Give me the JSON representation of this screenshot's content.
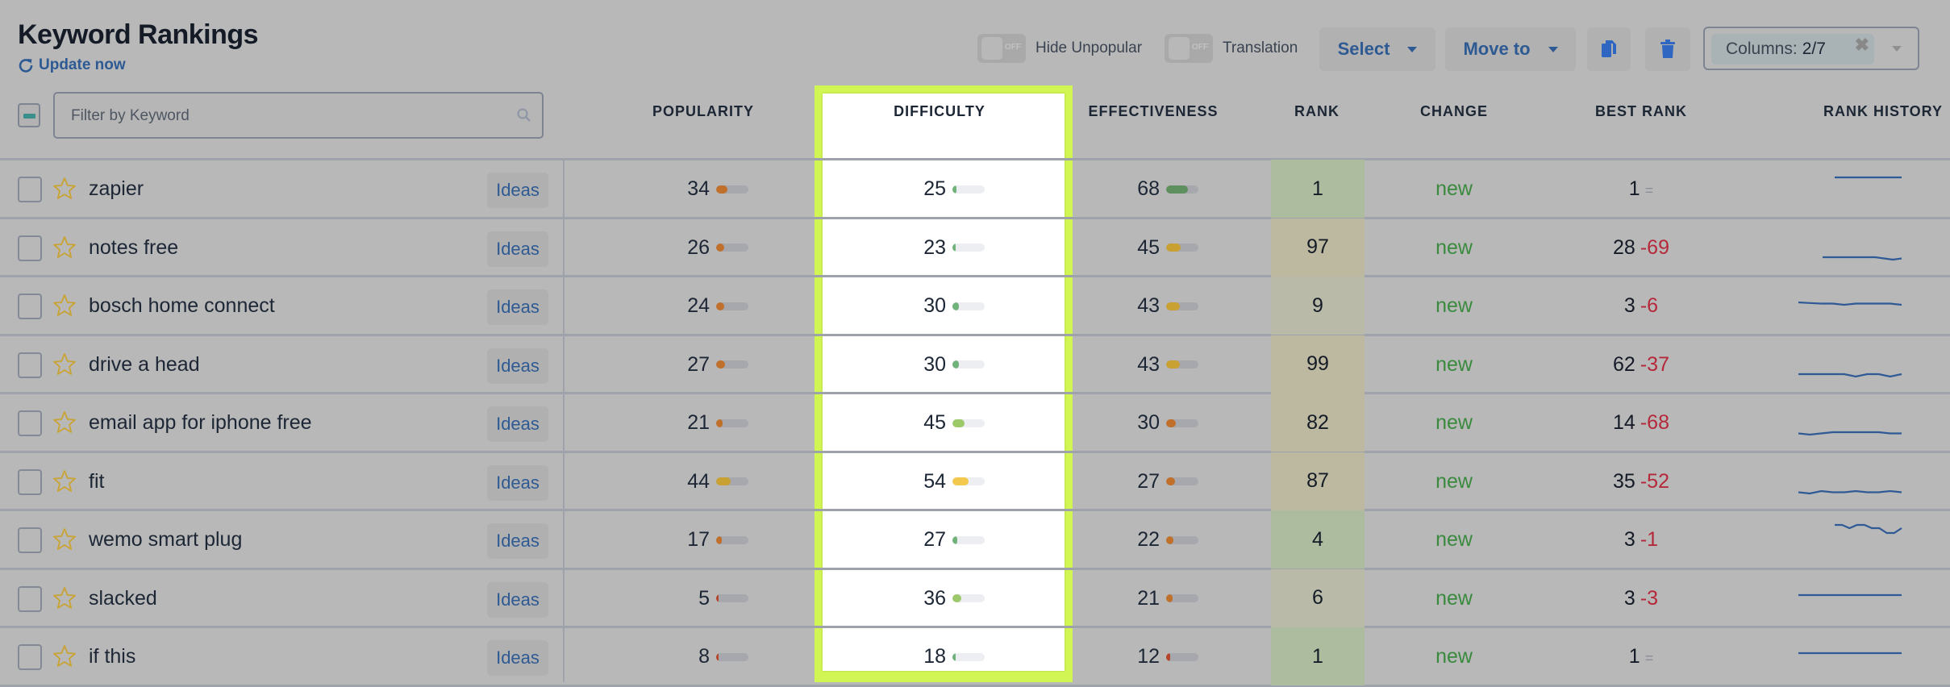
{
  "header": {
    "title": "Keyword Rankings",
    "update_label": "Update now",
    "toggles": [
      {
        "label": "Hide Unpopular",
        "state": "OFF"
      },
      {
        "label": "Translation",
        "state": "OFF"
      }
    ],
    "select_label": "Select",
    "move_to_label": "Move to",
    "copy_icon": "copy-icon",
    "delete_icon": "trash-icon",
    "columns_label": "Columns:",
    "columns_value": "2/7"
  },
  "filter": {
    "placeholder": "Filter by Keyword",
    "value": ""
  },
  "columns": {
    "popularity": "POPULARITY",
    "difficulty": "DIFFICULTY",
    "effectiveness": "EFFECTIVENESS",
    "rank": "RANK",
    "change": "CHANGE",
    "best_rank": "BEST RANK",
    "rank_history": "RANK HISTORY"
  },
  "highlighted_column": "DIFFICULTY",
  "colors": {
    "accent_blue": "#2e5a94",
    "highlight": "#d1f552",
    "change_green": "#3a8a3e",
    "delta_red": "#b5283a",
    "star": "#c9a332"
  },
  "ideas_label": "Ideas",
  "rows": [
    {
      "keyword": "zapier",
      "popularity": 34,
      "difficulty": 25,
      "effectiveness": 68,
      "rank": "1",
      "rank_tone": "good",
      "change": "new",
      "best_rank": "1",
      "best_delta": "=",
      "history": [
        1,
        1,
        1,
        1,
        1,
        1,
        1,
        1,
        1,
        1
      ]
    },
    {
      "keyword": "notes free",
      "popularity": 26,
      "difficulty": 23,
      "effectiveness": 45,
      "rank": "97",
      "rank_tone": "poor",
      "change": "new",
      "best_rank": "28",
      "best_delta": "-69",
      "history": [
        96,
        96,
        96,
        96,
        96,
        96,
        96,
        97,
        98,
        97
      ]
    },
    {
      "keyword": "bosch home connect",
      "popularity": 24,
      "difficulty": 30,
      "effectiveness": 43,
      "rank": "9",
      "rank_tone": "mid",
      "change": "new",
      "best_rank": "3",
      "best_delta": "-6",
      "history": [
        5,
        6,
        7,
        7,
        9,
        7,
        7,
        7,
        7,
        9
      ]
    },
    {
      "keyword": "drive a head",
      "popularity": 27,
      "difficulty": 30,
      "effectiveness": 43,
      "rank": "99",
      "rank_tone": "poor",
      "change": "new",
      "best_rank": "62",
      "best_delta": "-37",
      "history": [
        98,
        98,
        98,
        98,
        98,
        99,
        98,
        98,
        99,
        98
      ]
    },
    {
      "keyword": "email app for iphone free",
      "popularity": 21,
      "difficulty": 45,
      "effectiveness": 30,
      "rank": "82",
      "rank_tone": "poor",
      "change": "new",
      "best_rank": "14",
      "best_delta": "-68",
      "history": [
        82,
        83,
        82,
        81,
        81,
        81,
        81,
        81,
        82,
        82
      ]
    },
    {
      "keyword": "fit",
      "popularity": 44,
      "difficulty": 54,
      "effectiveness": 27,
      "rank": "87",
      "rank_tone": "poor",
      "change": "new",
      "best_rank": "35",
      "best_delta": "-52",
      "history": [
        87,
        88,
        86,
        87,
        87,
        86,
        87,
        87,
        86,
        87
      ]
    },
    {
      "keyword": "wemo smart plug",
      "popularity": 17,
      "difficulty": 27,
      "effectiveness": 22,
      "rank": "4",
      "rank_tone": "good",
      "change": "new",
      "best_rank": "3",
      "best_delta": "-1",
      "history": [
        3,
        3,
        5,
        3,
        3,
        5,
        5,
        8,
        8,
        5
      ]
    },
    {
      "keyword": "slacked",
      "popularity": 5,
      "difficulty": 36,
      "effectiveness": 21,
      "rank": "6",
      "rank_tone": "mid",
      "change": "new",
      "best_rank": "3",
      "best_delta": "-3",
      "history": [
        6,
        6,
        6,
        6,
        6,
        6,
        6,
        6,
        6,
        6
      ]
    },
    {
      "keyword": "if this",
      "popularity": 8,
      "difficulty": 18,
      "effectiveness": 12,
      "rank": "1",
      "rank_tone": "good",
      "change": "new",
      "best_rank": "1",
      "best_delta": "=",
      "history": [
        1,
        1,
        1,
        1,
        1,
        1,
        1,
        1,
        1,
        1
      ]
    }
  ]
}
